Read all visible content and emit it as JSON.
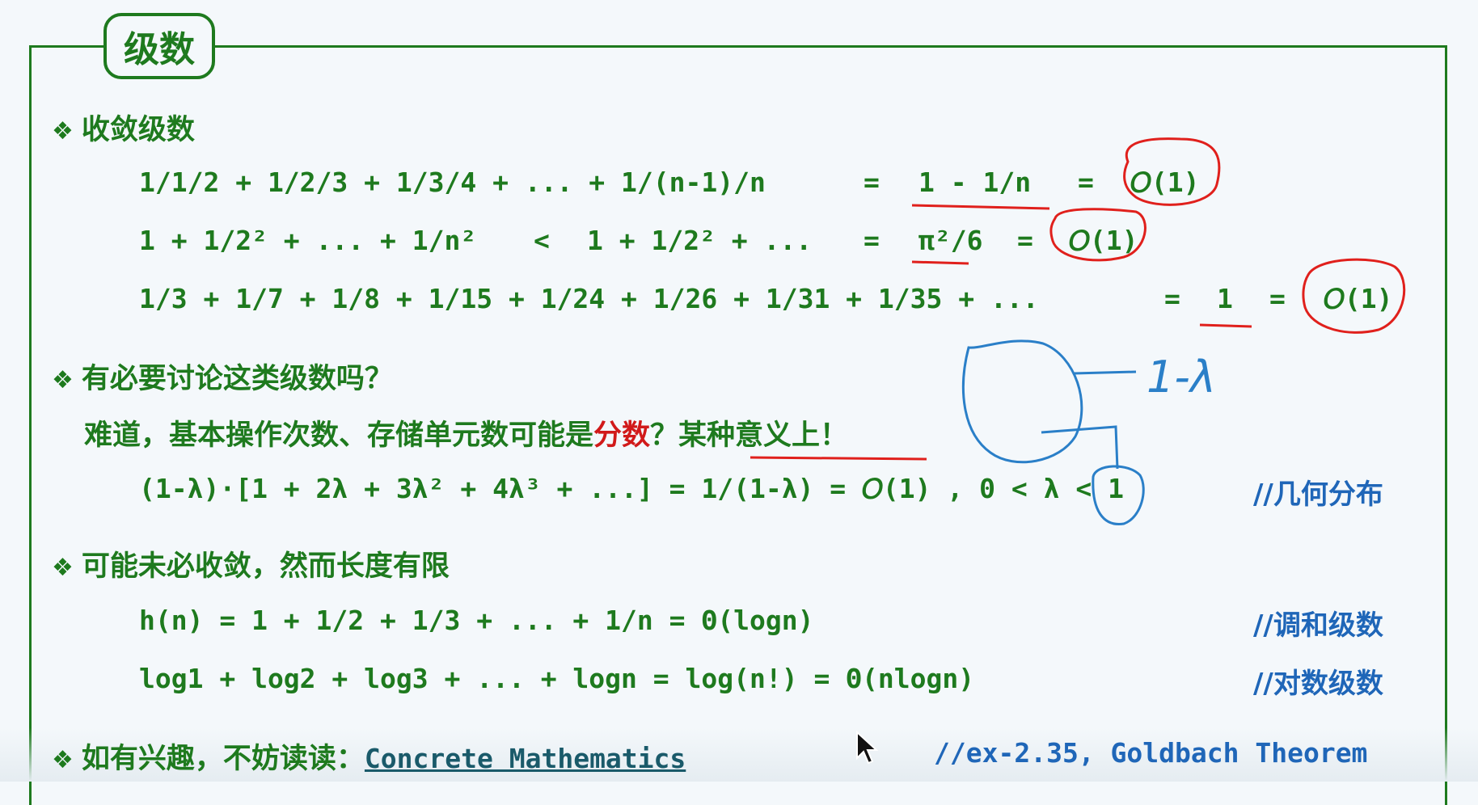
{
  "title": "级数",
  "sections": {
    "convergent": {
      "heading": "收敛级数",
      "row1": {
        "lhs": "1/1/2 + 1/2/3 + 1/3/4 + ... + 1/(n-1)/n",
        "eq1": "=",
        "mid": "1 - 1/n",
        "eq2": "=",
        "result": "𝑂(1)"
      },
      "row2": {
        "lhs": "1 + 1/2² + ... + 1/n²",
        "lt": "<",
        "mid1": "1 + 1/2² + ...",
        "eq1": "=",
        "mid2": "π²/6",
        "eq2": "=",
        "result": "𝑂(1)"
      },
      "row3": {
        "lhs": "1/3 + 1/7 + 1/8 + 1/15 + 1/24 + 1/26 + 1/31 + 1/35 + ...",
        "eq1": "=",
        "mid": "1",
        "eq2": "=",
        "result": "𝑂(1)"
      }
    },
    "necessary": {
      "heading": "有必要讨论这类级数吗？",
      "question_pre": "难道，基本操作次数、存储单元数可能是",
      "question_red": "分数",
      "question_mid": "？",
      "question_tail": "某种意义上！",
      "formula": "(1-λ)·[1 + 2λ + 3λ² + 4λ³ + ...] = 1/(1-λ) = 𝑂(1) , 0 < λ < 1",
      "comment": "//几何分布"
    },
    "divergent": {
      "heading": "可能未必收敛，然而长度有限",
      "row1": {
        "formula": "h(n) = 1 + 1/2 + 1/3 + ... + 1/n  =  Θ(logn)",
        "comment": "//调和级数"
      },
      "row2": {
        "formula": "log1 + log2 + log3 + ... + logn  =  log(n!)  =  Θ(nlogn)",
        "comment": "//对数级数"
      }
    },
    "reading": {
      "heading": "如有兴趣，不妨读读：",
      "book": "Concrete Mathematics",
      "comment": "//ex-2.35, Goldbach Theorem"
    }
  },
  "annotations": {
    "handwritten": "1-λ"
  },
  "colors": {
    "text_green": "#1e7a1e",
    "comment_blue": "#1f66b8",
    "highlight_red": "#d11a1a",
    "ink_red": "#e0201c",
    "ink_blue": "#2a7fc8"
  }
}
